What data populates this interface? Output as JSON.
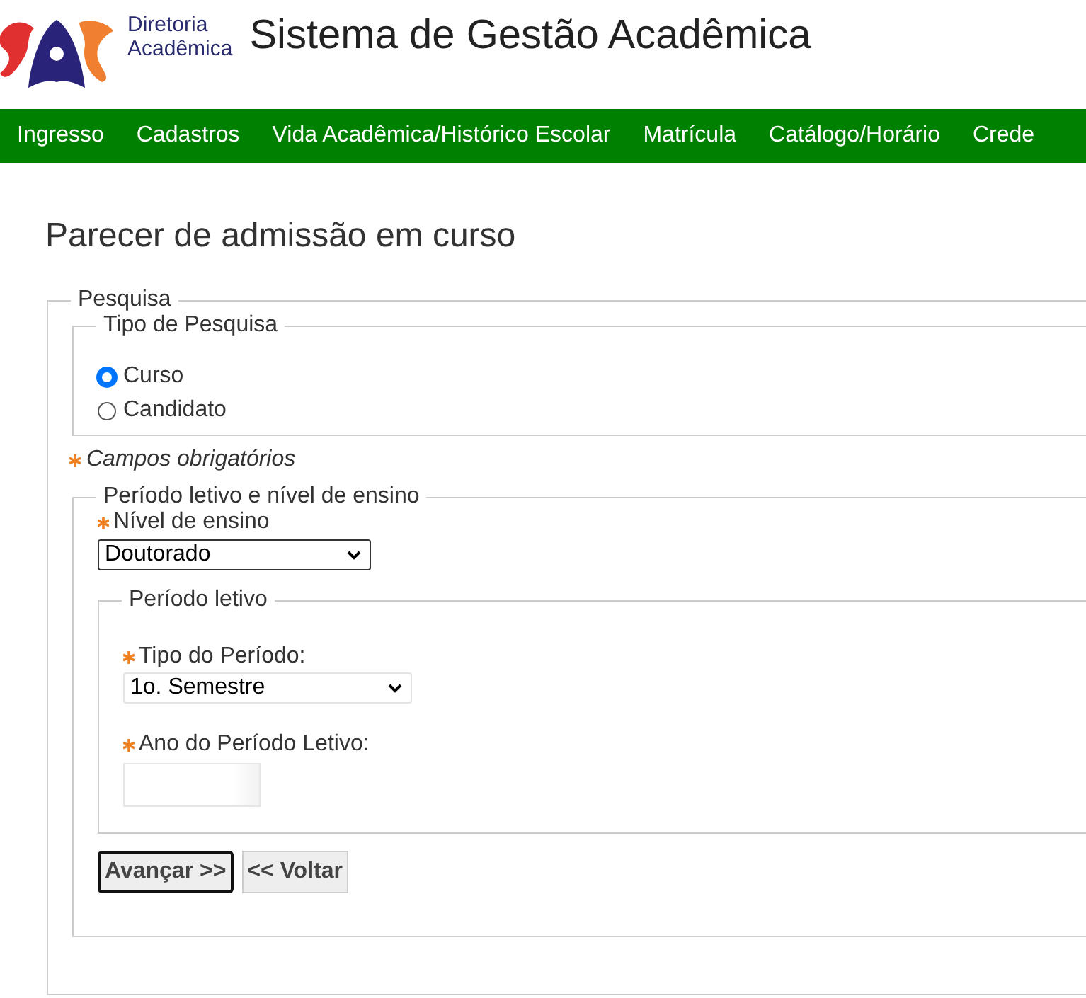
{
  "header": {
    "org_line1": "Diretoria",
    "org_line2": "Acadêmica",
    "title": "Sistema de Gestão Acadêmica"
  },
  "nav": [
    "Ingresso",
    "Cadastros",
    "Vida Acadêmica/Histórico Escolar",
    "Matrícula",
    "Catálogo/Horário",
    "Crede"
  ],
  "page_title": "Parecer de admissão em curso",
  "search": {
    "legend": "Pesquisa",
    "type_group": {
      "legend": "Tipo de Pesquisa",
      "options": [
        {
          "label": "Curso",
          "selected": true
        },
        {
          "label": "Candidato",
          "selected": false
        }
      ]
    },
    "required_note": "Campos obrigatórios",
    "period_group": {
      "legend": "Período letivo e nível de ensino",
      "level_field": {
        "label": "Nível de ensino",
        "required": true,
        "value": "Doutorado"
      },
      "period": {
        "legend": "Período letivo",
        "type_field": {
          "label": "Tipo do Período:",
          "required": true,
          "value": "1o. Semestre"
        },
        "year_field": {
          "label": "Ano do Período Letivo:",
          "required": true
        }
      }
    },
    "buttons": [
      {
        "label": "Avançar >>",
        "focused": true
      },
      {
        "label": "<< Voltar",
        "focused": false
      }
    ]
  }
}
